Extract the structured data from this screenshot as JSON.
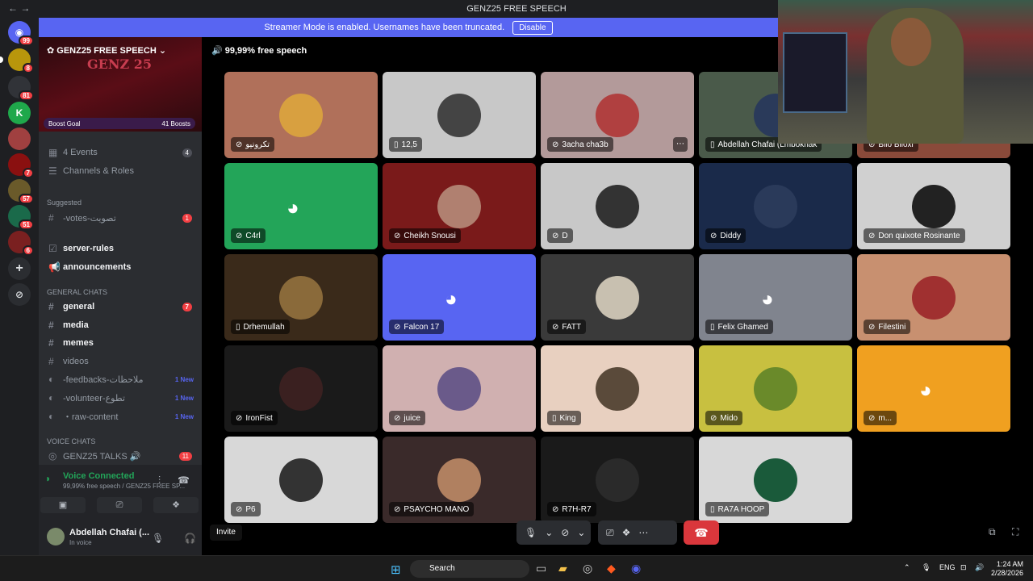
{
  "titlebar": {
    "title": "GENZ25 FREE SPEECH",
    "nav": "← →"
  },
  "banner": {
    "text": "Streamer Mode is enabled. Usernames have been truncated.",
    "button": "Disable"
  },
  "servers": [
    {
      "letter": "",
      "badge": "99",
      "color": "#5865f2"
    },
    {
      "letter": "",
      "badge": "8",
      "color": "#b8960c"
    },
    {
      "letter": "",
      "badge": "81",
      "color": "#313338"
    },
    {
      "letter": "K",
      "badge": "",
      "color": "#1fa84b"
    },
    {
      "letter": "",
      "badge": "",
      "color": "#a04040"
    },
    {
      "letter": "",
      "badge": "7",
      "color": "#8a1010"
    },
    {
      "letter": "",
      "badge": "57",
      "color": "#6a5a2a"
    },
    {
      "letter": "",
      "badge": "51",
      "color": "#1a6a4a"
    },
    {
      "letter": "",
      "badge": "6",
      "color": "#7a2020"
    }
  ],
  "server": {
    "name": "GENZ25 FREE SPEECH",
    "art": "GENZ 25",
    "boost_goal": "Boost Goal",
    "boosts": "41 Boosts"
  },
  "sidebar": {
    "events": {
      "label": "4 Events",
      "count": "4"
    },
    "roles": "Channels & Roles",
    "suggested": "Suggested",
    "votes": {
      "label": "-votes-تصويت",
      "badge": "1"
    },
    "server_rules": "server-rules",
    "announcements": "announcements",
    "general_chats": "GENERAL CHATS",
    "general": {
      "label": "general",
      "badge": "7"
    },
    "media": "media",
    "memes": "memes",
    "videos": "videos",
    "feedbacks": {
      "label": "-feedbacks-ملاحظات",
      "new": "1 New"
    },
    "volunteer": {
      "label": "-volunteer-تطوع",
      "new": "1 New"
    },
    "raw": {
      "label": "・raw-content",
      "new": "1 New"
    },
    "voice_chats": "VOICE CHATS",
    "genz_talks": {
      "label": "GENZ25 TALKS 🔊",
      "badge": "11"
    }
  },
  "voice": {
    "status": "Voice Connected",
    "sub": "99,99% free speech / GENZ25 FREE SP..."
  },
  "user": {
    "name": "Abdellah Chafai (...",
    "status": "In voice"
  },
  "main": {
    "channel_title": "99,99% free speech",
    "invite": "Invite"
  },
  "tiles": [
    {
      "name": "تكرونيو",
      "bg": "#b0705a",
      "av": "#d8a040",
      "mode": "avatar",
      "muted": true
    },
    {
      "name": "12,5",
      "bg": "#c8c8c8",
      "av": "#444",
      "mode": "avatar",
      "muted": false
    },
    {
      "name": "3acha cha3b",
      "bg": "#b39a9a",
      "av": "#b04040",
      "mode": "avatar",
      "muted": true
    },
    {
      "name": "Abdellah Chafai (Lmbokhak",
      "bg": "#4a5a4a",
      "av": "#2a3a5a",
      "mode": "avatar",
      "muted": false
    },
    {
      "name": "Bilo Biloxi",
      "bg": "#8a4a3a",
      "av": "#5a3a2a",
      "mode": "avatar",
      "muted": true
    },
    {
      "name": "C4rl",
      "bg": "#23a559",
      "av": "",
      "mode": "discord",
      "muted": true
    },
    {
      "name": "Cheikh Snousi",
      "bg": "#7a1a1a",
      "av": "#b08070",
      "mode": "avatar",
      "muted": true
    },
    {
      "name": "D",
      "bg": "#c8c8c8",
      "av": "#333",
      "mode": "avatar",
      "muted": true
    },
    {
      "name": "Diddy",
      "bg": "#1a2a4a",
      "av": "#2a3a5a",
      "mode": "avatar",
      "muted": true
    },
    {
      "name": "Don quixote Rosinante",
      "bg": "#d0d0d0",
      "av": "#222",
      "mode": "avatar",
      "muted": true
    },
    {
      "name": "Drhemullah",
      "bg": "#3a2a1a",
      "av": "#8a6a3a",
      "mode": "avatar",
      "muted": false
    },
    {
      "name": "Falcon 17",
      "bg": "#5865f2",
      "av": "",
      "mode": "discord",
      "muted": true
    },
    {
      "name": "FATT",
      "bg": "#3a3a3a",
      "av": "#c8c0b0",
      "mode": "avatar",
      "muted": true
    },
    {
      "name": "Felix Ghamed",
      "bg": "#80848e",
      "av": "",
      "mode": "discord",
      "muted": false
    },
    {
      "name": "Filestini",
      "bg": "#c89070",
      "av": "#a03030",
      "mode": "avatar",
      "muted": true
    },
    {
      "name": "IronFist",
      "bg": "#1a1a1a",
      "av": "#3a2020",
      "mode": "avatar",
      "muted": true
    },
    {
      "name": "juice",
      "bg": "#d0b0b0",
      "av": "#6a5a8a",
      "mode": "avatar",
      "muted": true
    },
    {
      "name": "King",
      "bg": "#e8d0c0",
      "av": "#5a4a3a",
      "mode": "avatar",
      "muted": false
    },
    {
      "name": "Mido",
      "bg": "#c8c040",
      "av": "#6a8a2a",
      "mode": "avatar",
      "muted": true
    },
    {
      "name": "m...",
      "bg": "#f0a020",
      "av": "",
      "mode": "discord",
      "muted": true
    },
    {
      "name": "P6",
      "bg": "#d8d8d8",
      "av": "#333",
      "mode": "avatar",
      "muted": true
    },
    {
      "name": "PSAYCHO MANO",
      "bg": "#3a2a2a",
      "av": "#b08060",
      "mode": "avatar",
      "muted": true
    },
    {
      "name": "R7H-R7",
      "bg": "#1a1a1a",
      "av": "#2a2a2a",
      "mode": "avatar",
      "muted": true
    },
    {
      "name": "RA7A HOOP",
      "bg": "#d8d8d8",
      "av": "#1a5a3a",
      "mode": "avatar",
      "muted": false
    }
  ],
  "taskbar": {
    "search": "Search",
    "lang": "ENG",
    "time": "1:24 AM",
    "date": "2/28/2026"
  }
}
